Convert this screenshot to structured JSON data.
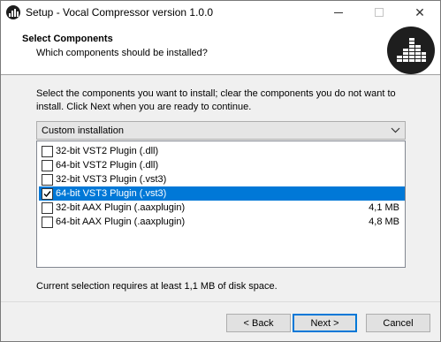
{
  "window": {
    "title": "Setup - Vocal Compressor version 1.0.0",
    "controls": {
      "minimize": "minimize",
      "maximize": "maximize",
      "close": "✕"
    }
  },
  "header": {
    "title": "Select Components",
    "subtitle": "Which components should be installed?",
    "logo_icon": "equalizer-logo-icon"
  },
  "description": "Select the components you want to install; clear the components you do not want to install. Click Next when you are ready to continue.",
  "install_type": {
    "selected": "Custom installation"
  },
  "components": [
    {
      "label": "32-bit VST2 Plugin (.dll)",
      "size": "",
      "checked": false,
      "selected": false
    },
    {
      "label": "64-bit VST2 Plugin (.dll)",
      "size": "",
      "checked": false,
      "selected": false
    },
    {
      "label": "32-bit VST3 Plugin (.vst3)",
      "size": "",
      "checked": false,
      "selected": false
    },
    {
      "label": "64-bit VST3 Plugin (.vst3)",
      "size": "",
      "checked": true,
      "selected": true
    },
    {
      "label": "32-bit AAX Plugin (.aaxplugin)",
      "size": "4,1 MB",
      "checked": false,
      "selected": false
    },
    {
      "label": "64-bit AAX Plugin (.aaxplugin)",
      "size": "4,8 MB",
      "checked": false,
      "selected": false
    }
  ],
  "status_text": "Current selection requires at least 1,1 MB of disk space.",
  "buttons": {
    "back": "< Back",
    "next": "Next >",
    "cancel": "Cancel"
  },
  "colors": {
    "selection": "#0078d7",
    "window_bg": "#f0f0f0"
  }
}
